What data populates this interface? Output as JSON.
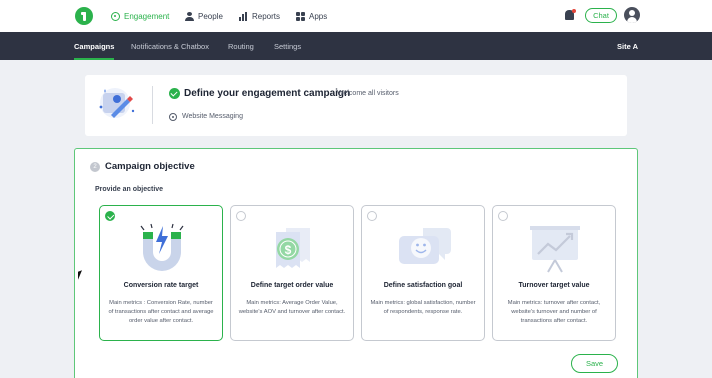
{
  "topnav": {
    "items": [
      {
        "label": "Engagement",
        "icon": "engagement-icon",
        "active": true
      },
      {
        "label": "People",
        "icon": "people-icon"
      },
      {
        "label": "Reports",
        "icon": "reports-icon"
      },
      {
        "label": "Apps",
        "icon": "apps-icon"
      }
    ],
    "chat_label": "Chat",
    "accent": "#2bb24c"
  },
  "subnav": {
    "tabs": [
      "Campaigns",
      "Notifications & Chatbox",
      "Routing",
      "Settings"
    ],
    "active": "Campaigns",
    "site": "Site A"
  },
  "define": {
    "title": "Define your engagement campaign",
    "subtitle": "Welcome all visitors",
    "channel": "Website Messaging"
  },
  "objective": {
    "step": "2",
    "title": "Campaign objective",
    "provide_label": "Provide an objective",
    "cards": [
      {
        "title": "Conversion rate target",
        "desc": "Main metrics : Conversion Rate, number of transactions after contact and average order value after contact.",
        "icon": "magnet-icon",
        "selected": true
      },
      {
        "title": "Define target order value",
        "desc": "Main metrics: Average Order Value, website's AOV and turnover after contact.",
        "icon": "receipt-dollar-icon",
        "selected": false
      },
      {
        "title": "Define satisfaction goal",
        "desc": "Main metrics: global satisfaction, number of respondents, response rate.",
        "icon": "smiley-chat-icon",
        "selected": false
      },
      {
        "title": "Turnover target value",
        "desc": "Main metrics: turnover after contact, website's turnover and number of transactions after contact.",
        "icon": "growth-chart-icon",
        "selected": false
      }
    ],
    "save_label": "Save"
  }
}
